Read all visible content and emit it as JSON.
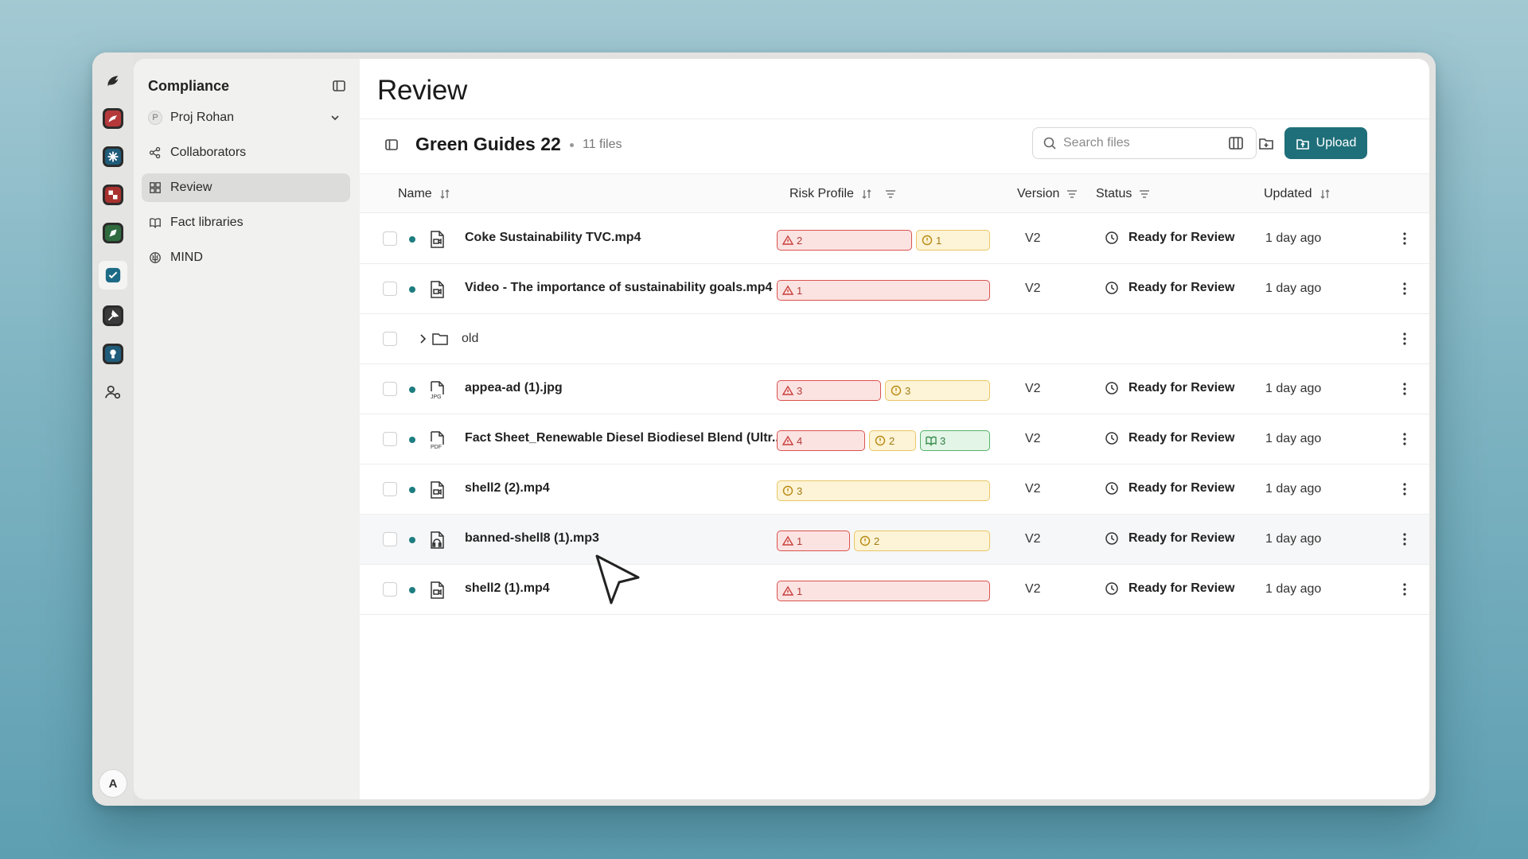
{
  "sidebar": {
    "title": "Compliance",
    "project": {
      "badge": "P",
      "name": "Proj Rohan"
    },
    "items": [
      {
        "label": "Collaborators",
        "icon": "share-icon"
      },
      {
        "label": "Review",
        "icon": "grid-icon",
        "active": true
      },
      {
        "label": "Fact libraries",
        "icon": "book-icon"
      },
      {
        "label": "MIND",
        "icon": "brain-icon"
      }
    ]
  },
  "rail": {
    "avatar": "A"
  },
  "main": {
    "title": "Review",
    "folder": {
      "name": "Green Guides 22",
      "count": "11 files"
    },
    "search": {
      "placeholder": "Search files"
    },
    "upload_label": "Upload",
    "columns": {
      "name": "Name",
      "risk": "Risk Profile",
      "version": "Version",
      "status": "Status",
      "updated": "Updated"
    },
    "rows": [
      {
        "name": "Coke Sustainability TVC.mp4",
        "type": "video",
        "risks": [
          {
            "level": "red",
            "count": "2"
          },
          {
            "level": "yellow",
            "count": "1"
          }
        ],
        "version": "V2",
        "status": "Ready for Review",
        "updated": "1 day ago"
      },
      {
        "name": "Video - The importance of sustainability goals.mp4",
        "type": "video",
        "risks": [
          {
            "level": "red",
            "count": "1"
          }
        ],
        "version": "V2",
        "status": "Ready for Review",
        "updated": "1 day ago"
      },
      {
        "name": "old",
        "type": "folder"
      },
      {
        "name": "appea-ad (1).jpg",
        "type": "jpg",
        "risks": [
          {
            "level": "red",
            "count": "3"
          },
          {
            "level": "yellow",
            "count": "3"
          }
        ],
        "version": "V2",
        "status": "Ready for Review",
        "updated": "1 day ago"
      },
      {
        "name": "Fact Sheet_Renewable Diesel Biodiesel Blend (Ultr...",
        "type": "pdf",
        "risks": [
          {
            "level": "red",
            "count": "4"
          },
          {
            "level": "yellow",
            "count": "2"
          },
          {
            "level": "green",
            "count": "3"
          }
        ],
        "version": "V2",
        "status": "Ready for Review",
        "updated": "1 day ago"
      },
      {
        "name": "shell2 (2).mp4",
        "type": "video",
        "risks": [
          {
            "level": "yellow",
            "count": "3"
          }
        ],
        "version": "V2",
        "status": "Ready for Review",
        "updated": "1 day ago"
      },
      {
        "name": "banned-shell8 (1).mp3",
        "type": "audio",
        "risks": [
          {
            "level": "red",
            "count": "1"
          },
          {
            "level": "yellow",
            "count": "2"
          }
        ],
        "version": "V2",
        "status": "Ready for Review",
        "updated": "1 day ago"
      },
      {
        "name": "shell2 (1).mp4",
        "type": "video",
        "risks": [
          {
            "level": "red",
            "count": "1"
          }
        ],
        "version": "V2",
        "status": "Ready for Review",
        "updated": "1 day ago"
      }
    ]
  },
  "colors": {
    "accent": "#1f6f7a",
    "risk_red": "#d9534f",
    "risk_yellow": "#e8c766",
    "risk_green": "#54b36a",
    "status_dot": "#1e7d80"
  }
}
